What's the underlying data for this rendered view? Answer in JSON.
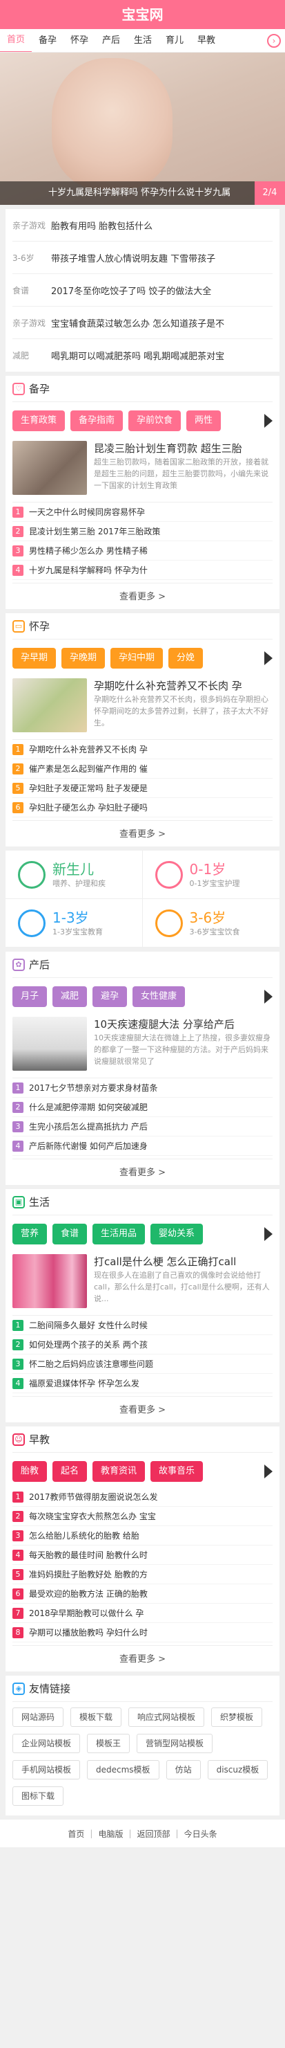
{
  "header": {
    "title": "宝宝网"
  },
  "nav": {
    "items": [
      "首页",
      "备孕",
      "怀孕",
      "产后",
      "生活",
      "育儿",
      "早教"
    ]
  },
  "banner": {
    "caption": "十岁九属是科学解释吗 怀孕为什么说十岁九属",
    "pager": "2/4"
  },
  "news": [
    {
      "cat": "亲子游戏",
      "title": "胎教有用吗 胎教包括什么"
    },
    {
      "cat": "3-6岁",
      "title": "带孩子堆雪人放心情说明友趣 下雪带孩子"
    },
    {
      "cat": "食谱",
      "title": "2017冬至你吃饺子了吗 饺子的做法大全"
    },
    {
      "cat": "亲子游戏",
      "title": "宝宝辅食蔬菜过敏怎么办 怎么知道孩子是不"
    },
    {
      "cat": "减肥",
      "title": "喝乳期可以喝减肥茶吗 喝乳期喝减肥茶对宝"
    }
  ],
  "sections": [
    {
      "title": "备孕",
      "color": "#ff6f8f",
      "tags": [
        "生育政策",
        "备孕指南",
        "孕前饮食",
        "两性"
      ],
      "feat_title": "昆凌三胎计划生育罚款 超生三胎",
      "feat_desc": "超生三胎罚款吗，随着国家二胎政策的开放，接着就是超生三胎的问题，超生三胎要罚款吗，小编先来说一下国家的计划生育政策",
      "items": [
        "一天之中什么时候同房容易怀孕",
        "昆凌计划生第三胎 2017年三胎政策",
        "男性精子稀少怎么办 男性精子稀",
        "十岁九属是科学解释吗 怀孕为什"
      ],
      "more": "查看更多 >"
    },
    {
      "title": "怀孕",
      "color": "#ff9c1e",
      "tags": [
        "孕早期",
        "孕晚期",
        "孕妇中期",
        "分娩"
      ],
      "feat_title": "孕期吃什么补充营养又不长肉 孕",
      "feat_desc": "孕期吃什么补充营养又不长肉，很多妈妈在孕期担心怀孕期间吃的太多营养过剩，长胖了，孩子太大不好生。",
      "items": [
        "孕期吃什么补充营养又不长肉 孕",
        "催产素是怎么起到催产作用的 催",
        "孕妇肚子发硬正常吗 肚子发硬是",
        "孕妇肚子硬怎么办 孕妇肚子硬吗"
      ],
      "more": "查看更多 >"
    }
  ],
  "grid": [
    {
      "title": "新生儿",
      "sub": "喂养、护理和疾",
      "color": "#3cb97a"
    },
    {
      "title": "0-1岁",
      "sub": "0-1岁宝宝护理",
      "color": "#ff6f8f"
    },
    {
      "title": "1-3岁",
      "sub": "1-3岁宝宝教育",
      "color": "#2ea3f2"
    },
    {
      "title": "3-6岁",
      "sub": "3-6岁宝宝饮食",
      "color": "#ff9c1e"
    }
  ],
  "sections2": [
    {
      "title": "产后",
      "color": "#b47ccd",
      "tags": [
        "月子",
        "减肥",
        "避孕",
        "女性健康"
      ],
      "feat_title": "10天疾速瘦腿大法 分享给产后",
      "feat_desc": "10天疾速瘦腿大法在微雄上上了热搜，很多妻奴瘦身的都拿了一整一下这种瘦腿的方法。对于产后妈妈来说瘦腿就很常见了",
      "items": [
        "2017七夕节想亲对方要求身材苗条",
        "什么是减肥停滞期 如何突破减肥",
        "生完小孩后怎么提高抵抗力 产后",
        "产后新陈代谢慢 如何产后加速身"
      ],
      "more": "查看更多 >"
    },
    {
      "title": "生活",
      "color": "#1fb86a",
      "tags": [
        "营养",
        "食谱",
        "生活用品",
        "婴幼关系"
      ],
      "feat_title": "打call是什么梗 怎么正确打call",
      "feat_desc": "现在很多人在追剧了自己喜欢的偶像时会说给他打call，那么什么是打call，打call是什么梗啊，还有人说...",
      "items": [
        "二胎间隔多久最好 女性什么时候",
        "如何处理两个孩子的关系 两个孩",
        "怀二胎之后妈妈应该注意哪些问题",
        "福原爱退媒体怀孕 怀孕怎么发"
      ],
      "more": "查看更多 >"
    },
    {
      "title": "早教",
      "color": "#ee2f5c",
      "tags": [
        "胎教",
        "起名",
        "教育资讯",
        "故事音乐"
      ],
      "items": [
        "2017教师节做得朋友圈说说怎么发",
        "每次晓宝宝穿衣大煎熬怎么办 宝宝",
        "怎么给胎儿系统化的胎教 给胎",
        "每天胎教的最佳时间 胎教什么时",
        "准妈妈摸肚子胎教好处 胎教的方",
        "最受欢迎的胎教方法 正确的胎教",
        "2018孕早期胎教可以做什么 孕",
        "孕期可以播放胎教吗 孕妇什么时"
      ],
      "more": "查看更多 >"
    }
  ],
  "links": {
    "title": "友情链接",
    "items": [
      "网站源码",
      "模板下载",
      "响应式网站模板",
      "织梦模板",
      "企业网站模板",
      "模板王",
      "营销型网站模板",
      "手机网站模板",
      "dedecms模板",
      "仿站",
      "discuz模板",
      "图标下载"
    ]
  },
  "footer": [
    "首页",
    "电脑版",
    "返回顶部",
    "今日头条"
  ]
}
